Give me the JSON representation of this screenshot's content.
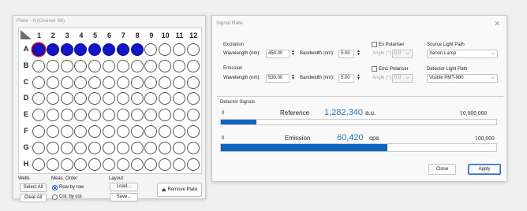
{
  "plate_window": {
    "title": "Plate - 0 (Greiner 96)",
    "columns": [
      "1",
      "2",
      "3",
      "4",
      "5",
      "6",
      "7",
      "8",
      "9",
      "10",
      "11",
      "12"
    ],
    "rows": [
      "A",
      "B",
      "C",
      "D",
      "E",
      "F",
      "G",
      "H"
    ],
    "filled_wells_row_A": 8,
    "well_fill_color": "#1414c8",
    "selected_well_color": "#d01010",
    "wells_group": {
      "label": "Wells",
      "select_all": "Select All",
      "clear_all": "Clear All"
    },
    "meas_order_group": {
      "label": "Meas. Order",
      "row_by_row": "Row by row",
      "col_by_col": "Col. by col."
    },
    "layout_group": {
      "label": "Layout",
      "load": "Load...",
      "save": "Save..."
    },
    "remove_plate": "Remove Plate"
  },
  "signal_window": {
    "title": "Signal Rate",
    "close_glyph": "✕",
    "excitation": {
      "label": "Excitation",
      "wavelength_label": "Wavelength (nm):",
      "wavelength": "450.00",
      "bandwidth_label": "Bandwidth (nm):",
      "bandwidth": "5.00",
      "polariser_label": "Ex Polariser",
      "angle_label": "Angle (°):",
      "angle": "0.0",
      "source_label": "Source Light Path",
      "source_value": "Xenon Lamp"
    },
    "emission": {
      "label": "Emission",
      "wavelength_label": "Wavelength (nm):",
      "wavelength": "530.00",
      "bandwidth_label": "Bandwidth (nm):",
      "bandwidth": "5.00",
      "polariser_label": "Em1 Polariser",
      "angle_label": "Angle (°):",
      "angle": "0.0",
      "detector_label": "Detector Light Path",
      "detector_value": "Visible PMT-980"
    },
    "detector_signals": {
      "label": "Detector Signals",
      "reference": {
        "zero": "0",
        "name": "Reference",
        "value": "1,282,340",
        "unit": "a.u.",
        "max": "10,000,000",
        "fraction": 0.128
      },
      "emission": {
        "zero": "0",
        "name": "Emission",
        "value": "60,420",
        "unit": "cps",
        "max": "100,000",
        "fraction": 0.604
      }
    },
    "close_button": "Close",
    "apply_button": "Apply",
    "accent_color": "#0e64c0"
  }
}
